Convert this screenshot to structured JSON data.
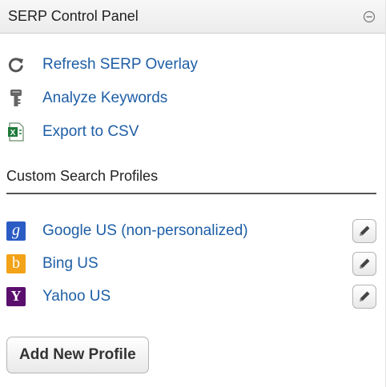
{
  "header": {
    "title": "SERP Control Panel",
    "collapse_icon": "minus-circle-icon"
  },
  "actions": [
    {
      "label": "Refresh SERP Overlay",
      "icon": "refresh-icon"
    },
    {
      "label": "Analyze Keywords",
      "icon": "key-icon"
    },
    {
      "label": "Export to CSV",
      "icon": "excel-file-icon"
    }
  ],
  "profiles_section": {
    "title": "Custom Search Profiles",
    "profiles": [
      {
        "label": "Google US (non-personalized)",
        "icon": "google-icon",
        "glyph": "g",
        "color": "#2a5cc4"
      },
      {
        "label": "Bing US",
        "icon": "bing-icon",
        "glyph": "b",
        "color": "#f2a318"
      },
      {
        "label": "Yahoo US",
        "icon": "yahoo-icon",
        "glyph": "Y",
        "color": "#5a0f6d"
      }
    ]
  },
  "add_button_label": "Add New Profile",
  "colors": {
    "link": "#1e5ea6",
    "heading": "#222222"
  }
}
